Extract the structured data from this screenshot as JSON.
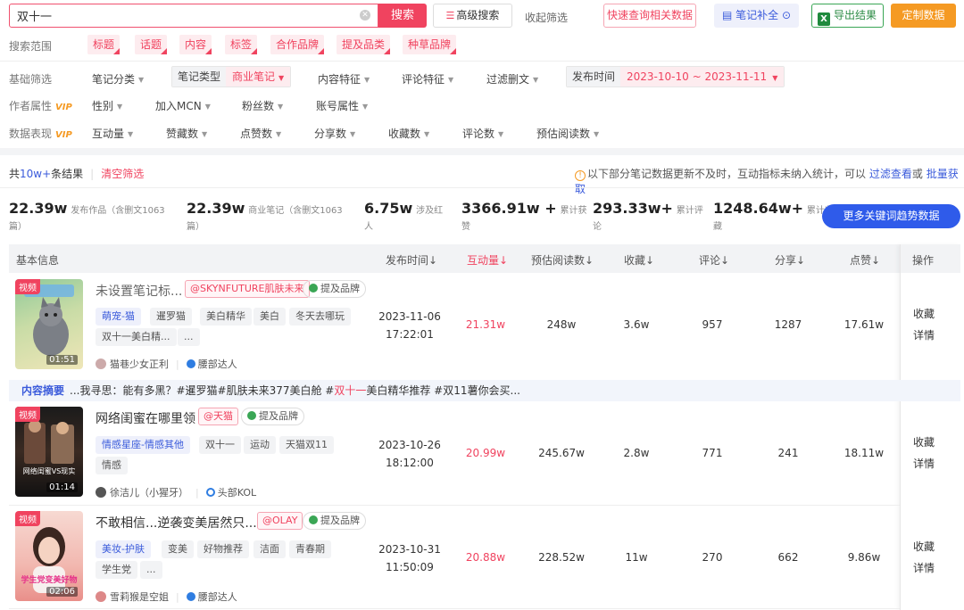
{
  "topbar": {
    "search_value": "双十一",
    "search_button": "搜索",
    "advanced_search": "高级搜索",
    "collect_filter": "收起筛选",
    "quick_query": "快速查询相关数据",
    "note_complete": "笔记补全",
    "export": "导出结果",
    "custom_data": "定制数据"
  },
  "scope": {
    "label": "搜索范围",
    "items": [
      "标题",
      "话题",
      "内容",
      "标签",
      "合作品牌",
      "提及品类",
      "种草品牌"
    ]
  },
  "filters": {
    "basic_label": "基础筛选",
    "note_category": "笔记分类",
    "note_type_key": "笔记类型",
    "note_type_value": "商业笔记",
    "content_feature": "内容特征",
    "comment_feature": "评论特征",
    "filter_deleted": "过滤删文",
    "publish_time_key": "发布时间",
    "publish_time_value": "2023-10-10 ~ 2023-11-11",
    "author_label": "作者属性",
    "gender": "性别",
    "mcn": "加入MCN",
    "fans": "粉丝数",
    "account_attr": "账号属性",
    "data_label": "数据表现",
    "vip": "VIP",
    "interaction": "互动量",
    "likes": "赞藏数",
    "dianzan": "点赞数",
    "shares": "分享数",
    "favorites": "收藏数",
    "comments": "评论数",
    "est_reads": "预估阅读数"
  },
  "result": {
    "prefix": "共",
    "count": "10w+",
    "suffix": "条结果",
    "clear": "清空筛选",
    "warning": "以下部分笔记数据更新不及时，互动指标未纳入统计，可以",
    "warning_link1": "过滤查看",
    "warning_or": "或",
    "warning_link2": "批量获取"
  },
  "stats": [
    {
      "value": "22.39w",
      "label": "发布作品（含删文1063",
      "label2": "篇）"
    },
    {
      "value": "22.39w",
      "label": "商业笔记（含删文1063",
      "label2": "篇）"
    },
    {
      "value": "6.75w",
      "label": "涉及红",
      "label2": "人"
    },
    {
      "value": "3366.91w +",
      "label": "累计获",
      "label2": "赞"
    },
    {
      "value": "293.33w+",
      "label": "累计评",
      "label2": "论"
    },
    {
      "value": "1248.64w+",
      "label": "累计收",
      "label2": "藏"
    }
  ],
  "trend_button": "更多关键词趋势数据",
  "table": {
    "headers": {
      "basic": "基本信息",
      "publish_time": "发布时间",
      "interaction": "互动量",
      "est_reads": "预估阅读数",
      "favorites": "收藏",
      "comments": "评论",
      "shares": "分享",
      "likes": "点赞",
      "ops": "操作"
    },
    "sort_arrow": "↓",
    "rows": [
      {
        "video_tag": "视频",
        "duration": "01:51",
        "title": "未设置笔记标...",
        "brand": "@SKYNFUTURE肌肤未来",
        "mention": "提及品牌",
        "tags": [
          "萌宠-猫",
          "暹罗猫",
          "美白精华",
          "美白",
          "冬天去哪玩",
          "双十一美白精...",
          "..."
        ],
        "author": "猫巷少女正利",
        "level": "腰部达人",
        "date": "2023-11-06",
        "time": "17:22:01",
        "interaction": "21.31w",
        "reads": "248w",
        "favorites": "3.6w",
        "comments": "957",
        "shares": "1287",
        "likes": "17.61w",
        "op1": "收藏",
        "op2": "详情"
      },
      {
        "video_tag": "视频",
        "duration": "01:14",
        "thumb_text": "网络闺蜜VS现实",
        "title": "网络闺蜜在哪里领",
        "brand": "@天猫",
        "mention": "提及品牌",
        "tags": [
          "情感星座-情感其他",
          "双十一",
          "运动",
          "天猫双11",
          "情感"
        ],
        "author": "徐洁儿（小猩牙）",
        "level": "头部KOL",
        "date": "2023-10-26",
        "time": "18:12:00",
        "interaction": "20.99w",
        "reads": "245.67w",
        "favorites": "2.8w",
        "comments": "771",
        "shares": "241",
        "likes": "18.11w",
        "op1": "收藏",
        "op2": "详情"
      },
      {
        "video_tag": "视频",
        "duration": "02:06",
        "thumb_text": "学生党变美好物",
        "title": "不敢相信...逆袭变美居然只...",
        "brand": "@OLAY",
        "mention": "提及品牌",
        "tags": [
          "美妆-护肤",
          "变美",
          "好物推荐",
          "洁面",
          "青春期",
          "学生党",
          "..."
        ],
        "author": "雪莉猴是空姐",
        "level": "腰部达人",
        "date": "2023-10-31",
        "time": "11:50:09",
        "interaction": "20.88w",
        "reads": "228.52w",
        "favorites": "11w",
        "comments": "270",
        "shares": "662",
        "likes": "9.86w",
        "op1": "收藏",
        "op2": "详情"
      }
    ]
  },
  "summary": {
    "label": "内容摘要",
    "text_before": "...我寻思：能有多黑？#暹罗猫#肌肤未来377美白舱 #",
    "highlight": "双十一",
    "text_after": "美白精华推荐 #双11薯你会买..."
  },
  "colors": {
    "accent": "#f0435f",
    "blue": "#2f5bea",
    "orange": "#f59a23",
    "green": "#3aa655"
  }
}
